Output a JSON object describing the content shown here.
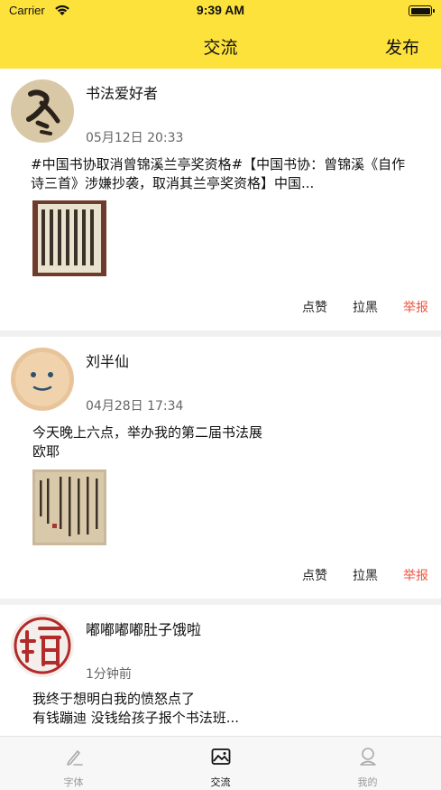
{
  "status_bar": {
    "carrier": "Carrier",
    "time": "9:39 AM"
  },
  "nav": {
    "title": "交流",
    "publish": "发布"
  },
  "posts": [
    {
      "author": "书法爱好者",
      "time": "05月12日 20:33",
      "text": "#中国书协取消曾锦溪兰亭奖资格#【中国书协：曾锦溪《自作诗三首》涉嫌抄袭，取消其兰亭奖资格】中国...",
      "actions": {
        "like": "点赞",
        "block": "拉黑",
        "report": "举报"
      }
    },
    {
      "author": "刘半仙",
      "time": "04月28日 17:34",
      "text": "今天晚上六点，举办我的第二届书法展\n欧耶",
      "actions": {
        "like": "点赞",
        "block": "拉黑",
        "report": "举报"
      }
    },
    {
      "author": "嘟嘟嘟嘟肚子饿啦",
      "time": "1分钟前",
      "text": "我终于想明白我的愤怒点了\n有钱蹦迪 没钱给孩子报个书法班..."
    }
  ],
  "tabs": [
    {
      "label": "字体",
      "icon": "pen-icon",
      "active": false
    },
    {
      "label": "交流",
      "icon": "picture-icon",
      "active": true
    },
    {
      "label": "我的",
      "icon": "profile-icon",
      "active": false
    }
  ],
  "colors": {
    "accent": "#fde23c",
    "report": "#f0533c"
  }
}
